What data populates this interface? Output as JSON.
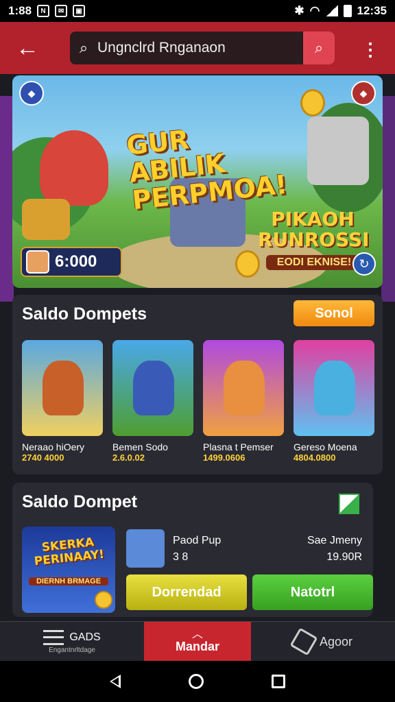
{
  "status_bar": {
    "time_left": "1:88",
    "time_right": "12:35"
  },
  "header": {
    "search_text": "Ungnclrd Rnganaon"
  },
  "banner": {
    "title": "GUR ABILIK PERPMOA!",
    "subtitle": "PIKAOH RUNROSSI",
    "subtitle_small": "EODI EKNISE!",
    "coins": "6:000"
  },
  "section1": {
    "title": "Saldo Dompets",
    "button_label": "Sonol",
    "cards": [
      {
        "name": "Neraao hiOery",
        "price": "2740 4000",
        "color1": "#5aa8e0",
        "color2": "#f0d060",
        "fig": "#c8602a"
      },
      {
        "name": "Bemen Sodo",
        "price": "2.6.0.02",
        "color1": "#4aa8e8",
        "color2": "#4e9e30",
        "fig": "#3a5ab8"
      },
      {
        "name": "Plasna t Pemser",
        "price": "1499.0606",
        "color1": "#b04ae0",
        "color2": "#f0a040",
        "fig": "#e89040"
      },
      {
        "name": "Gereso Moena",
        "price": "4804.0800",
        "color1": "#e040a0",
        "color2": "#60c0f0",
        "fig": "#4ab0e0"
      }
    ]
  },
  "section2": {
    "title": "Saldo Dompet",
    "promo_title": "SKERKA PERINAAY!",
    "promo_sub": "DIERNH BRMAGE",
    "item_name": "Paod Pup",
    "item_meta": "3 8",
    "price_label": "Sae Jmeny",
    "price_value": "19.90R",
    "button_yellow": "Dorrendad",
    "button_green": "Natotrl"
  },
  "tab_bar": {
    "left_label": "GADS",
    "left_sub": "Engantnrltdage",
    "center_label": "Mandar",
    "right_label": "Agoor"
  }
}
